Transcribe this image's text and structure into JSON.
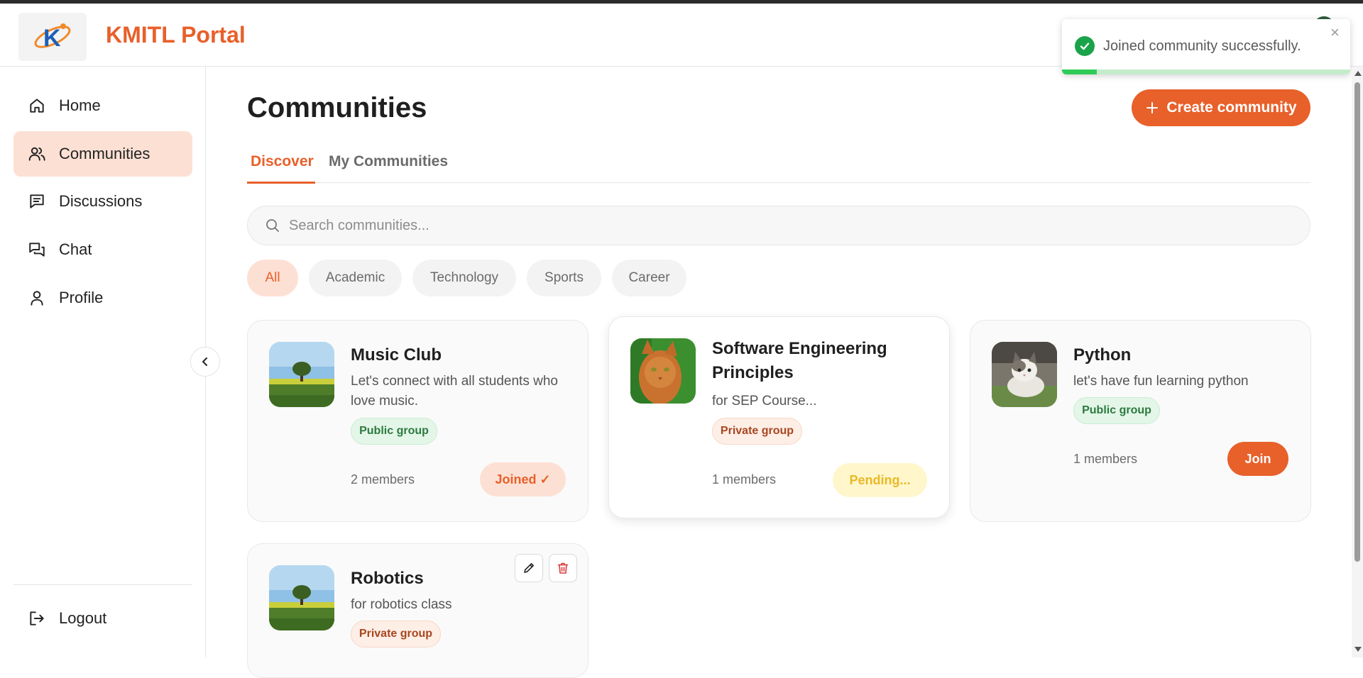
{
  "header": {
    "brand": "KMITL Portal",
    "logo_letter": "K"
  },
  "toast": {
    "message": "Joined community successfully.",
    "close": "×",
    "progress": 0.12,
    "color_success": "#1aa34a"
  },
  "sidebar": {
    "items": [
      {
        "label": "Home",
        "icon": "home-icon"
      },
      {
        "label": "Communities",
        "icon": "users-icon",
        "active": true
      },
      {
        "label": "Discussions",
        "icon": "message-square-icon"
      },
      {
        "label": "Chat",
        "icon": "chat-bubbles-icon"
      },
      {
        "label": "Profile",
        "icon": "user-icon"
      }
    ],
    "logout": "Logout"
  },
  "main": {
    "title": "Communities",
    "create_label": "Create community",
    "tabs": [
      {
        "label": "Discover",
        "active": true
      },
      {
        "label": "My Communities"
      }
    ],
    "search_placeholder": "Search communities...",
    "filters": [
      "All",
      "Academic",
      "Technology",
      "Sports",
      "Career"
    ],
    "active_filter": "All"
  },
  "cards": [
    {
      "title": "Music Club",
      "desc": "Let's connect with all students who love music.",
      "badge": "Public group",
      "members": "2 members",
      "action": "Joined ✓",
      "thumb": "landscape-tree"
    },
    {
      "title": "Software Engineering Principles",
      "desc": "for SEP Course...",
      "badge": "Private group",
      "members": "1 members",
      "action": "Pending...",
      "thumb": "orange-cat"
    },
    {
      "title": "Python",
      "desc": "let's have fun learning python",
      "badge": "Public group",
      "members": "1 members",
      "action": "Join",
      "thumb": "kitten"
    },
    {
      "title": "Robotics",
      "desc": "for robotics class",
      "badge": "Private group",
      "thumb": "landscape-tree"
    }
  ],
  "colors": {
    "accent": "#e8602a",
    "accent_soft": "#fde0d4",
    "public": "#2c7a3f",
    "pending": "#e9b925"
  }
}
